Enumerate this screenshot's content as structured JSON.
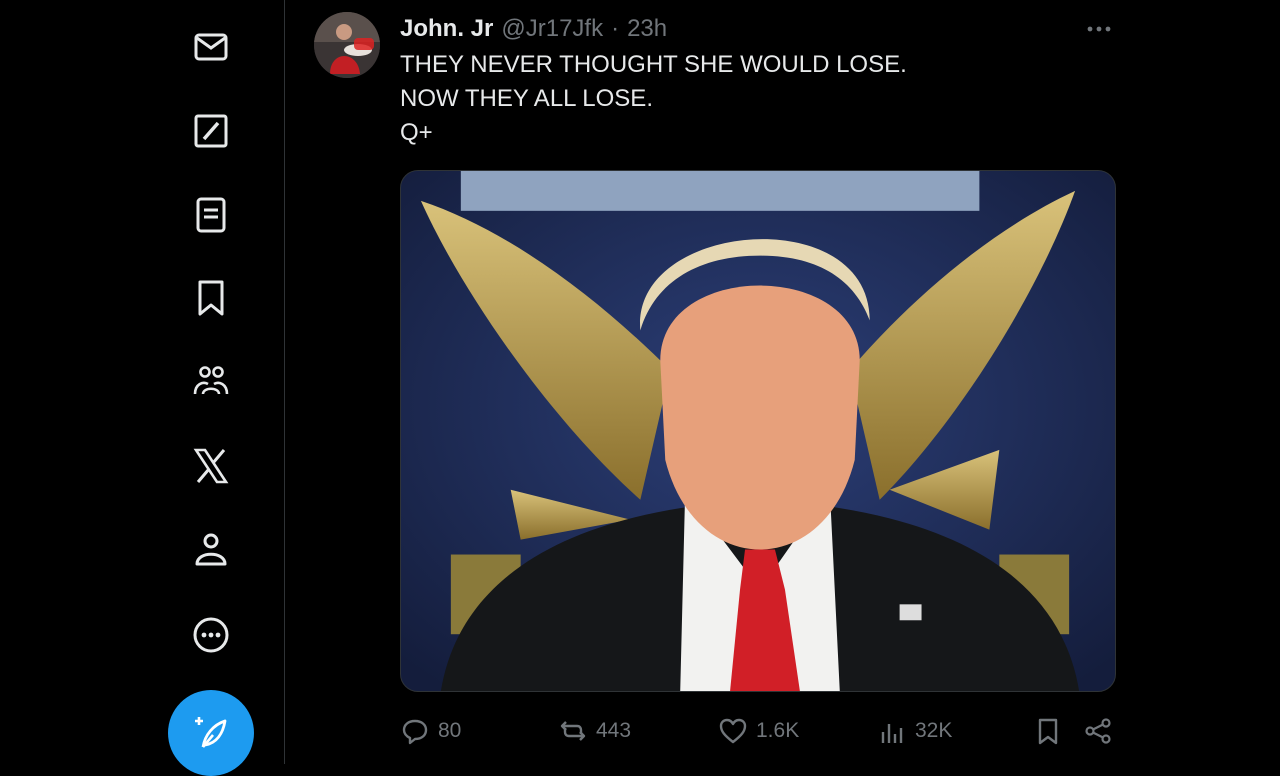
{
  "sidebar": {
    "items": [
      {
        "icon": "messages-icon"
      },
      {
        "icon": "grok-icon"
      },
      {
        "icon": "lists-icon"
      },
      {
        "icon": "bookmarks-icon"
      },
      {
        "icon": "communities-icon"
      },
      {
        "icon": "x-logo-icon"
      },
      {
        "icon": "profile-icon"
      },
      {
        "icon": "more-circle-icon"
      }
    ],
    "compose_icon": "feather-plus-icon",
    "accent_color": "#1d9bf0"
  },
  "tweet": {
    "display_name": "John. Jr",
    "handle": "@Jr17Jfk",
    "separator": "·",
    "time": "23h",
    "text_lines": [
      "THEY NEVER THOUGHT SHE WOULD LOSE.",
      "NOW THEY ALL LOSE.",
      "Q+"
    ]
  },
  "actions": {
    "replies": "80",
    "reposts": "443",
    "likes": "1.6K",
    "views": "32K"
  }
}
